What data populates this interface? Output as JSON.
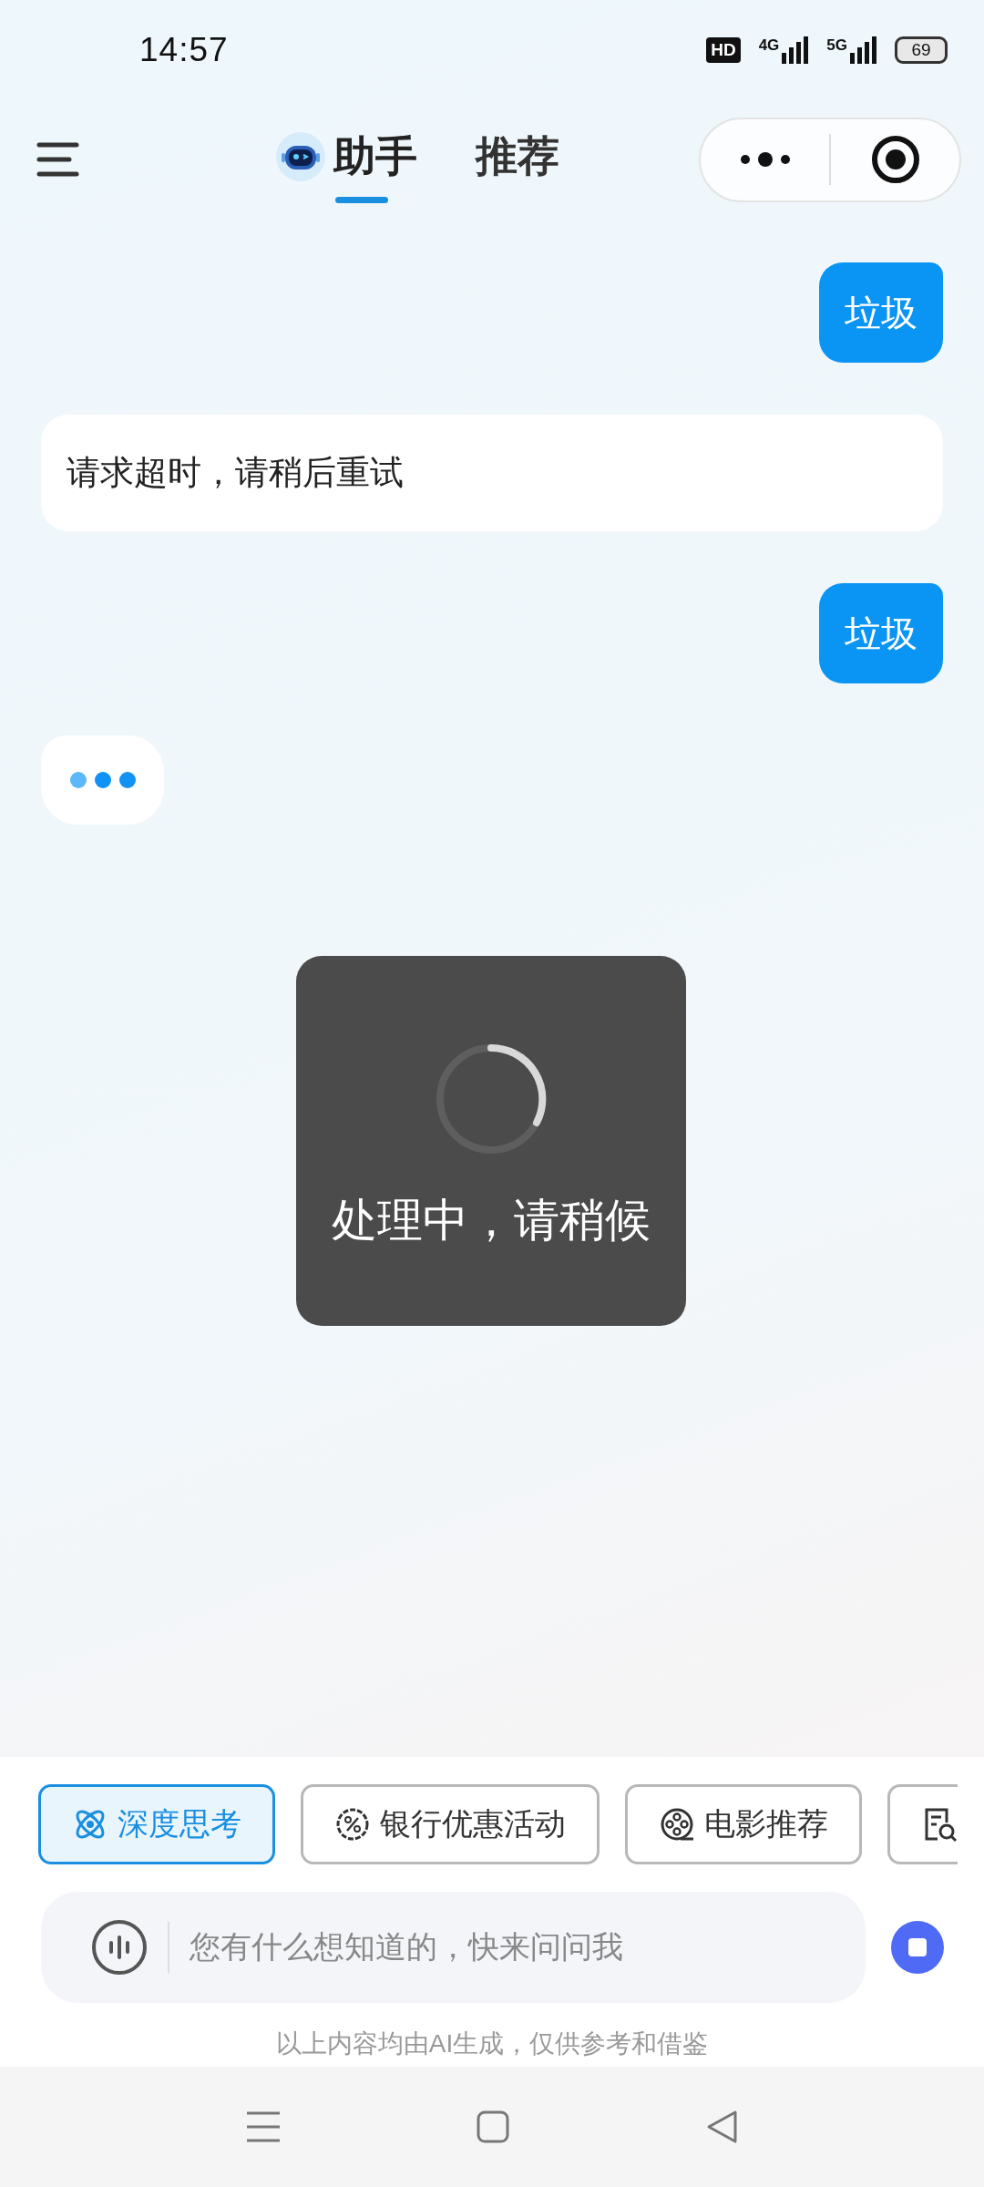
{
  "status_bar": {
    "time": "14:57",
    "hd": "HD",
    "network_1": "4G",
    "network_2": "5G",
    "battery": "69"
  },
  "header": {
    "tabs": [
      {
        "label": "助手",
        "selected": true
      },
      {
        "label": "推荐",
        "selected": false
      }
    ]
  },
  "messages": [
    {
      "kind": "user",
      "text": "垃圾"
    },
    {
      "kind": "bot",
      "text": "请求超时，请稍后重试"
    },
    {
      "kind": "user",
      "text": "垃圾"
    },
    {
      "kind": "typing"
    }
  ],
  "toast": {
    "text": "处理中，请稍候"
  },
  "chips": [
    {
      "label": "深度思考",
      "selected": true
    },
    {
      "label": "银行优惠活动",
      "selected": false
    },
    {
      "label": "电影推荐",
      "selected": false
    },
    {
      "selected": false
    }
  ],
  "input": {
    "placeholder": "您有什么想知道的，快来问问我"
  },
  "disclaimer": "以上内容均由AI生成，仅供参考和借鉴"
}
